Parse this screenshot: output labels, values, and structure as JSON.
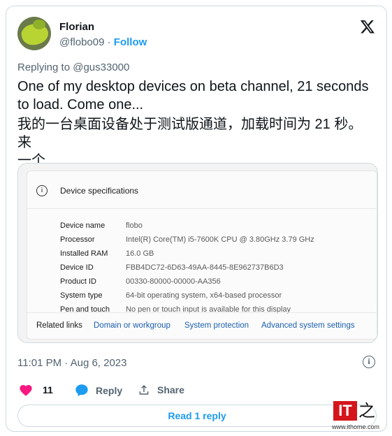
{
  "author": {
    "name": "Florian",
    "handle": "@flobo09",
    "separator": "·",
    "follow_label": "Follow"
  },
  "reply_context": {
    "prefix": "Replying to ",
    "mention": "@gus33000"
  },
  "tweet": {
    "text_en": "One of my desktop devices on beta channel, 21 seconds to load. Come one...",
    "text_zh_line1": "我的一台桌面设备处于测试版通道，加载时间为 21 秒。来",
    "text_zh_line2": "一个..."
  },
  "media": {
    "window_title": "Device specifications",
    "specs": [
      {
        "label": "Device name",
        "value": "flobo"
      },
      {
        "label": "Processor",
        "value": "Intel(R) Core(TM) i5-7600K CPU @ 3.80GHz   3.79 GHz"
      },
      {
        "label": "Installed RAM",
        "value": "16.0 GB"
      },
      {
        "label": "Device ID",
        "value": "FBB4DC72-6D63-49AA-8445-8E962737B6D3"
      },
      {
        "label": "Product ID",
        "value": "00330-80000-00000-AA356"
      },
      {
        "label": "System type",
        "value": "64-bit operating system, x64-based processor"
      },
      {
        "label": "Pen and touch",
        "value": "No pen or touch input is available for this display"
      }
    ],
    "related_links_label": "Related links",
    "related_links": [
      "Domain or workgroup",
      "System protection",
      "Advanced system settings"
    ]
  },
  "timestamp": "11:01 PM · Aug 6, 2023",
  "actions": {
    "likes_count": "11",
    "reply_label": "Reply",
    "share_label": "Share"
  },
  "read_reply_label": "Read 1 reply",
  "watermark": {
    "logo_text": "IT",
    "logo_char": "之",
    "url": "www.ithome.com"
  },
  "colors": {
    "accent": "#1d9bf0",
    "like": "#f91880",
    "muted": "#536471",
    "link": "#1b5fb0"
  },
  "icons": [
    "x-logo-icon",
    "info-circle-icon",
    "heart-icon",
    "reply-bubble-icon",
    "share-icon"
  ]
}
